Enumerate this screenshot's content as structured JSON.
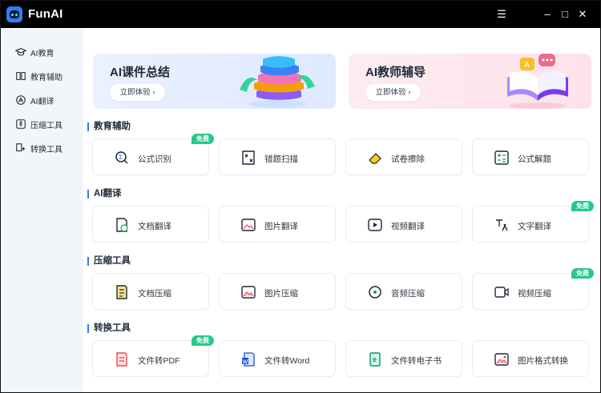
{
  "app": {
    "title": "FunAI"
  },
  "window_controls": {
    "menu": "☰",
    "minimize": "–",
    "maximize": "□",
    "close": "✕"
  },
  "sidebar": {
    "items": [
      {
        "label": "AI教育",
        "icon": "graduation-cap-icon"
      },
      {
        "label": "教育辅助",
        "icon": "book-icon"
      },
      {
        "label": "AI翻译",
        "icon": "translate-icon"
      },
      {
        "label": "压缩工具",
        "icon": "compress-icon"
      },
      {
        "label": "转换工具",
        "icon": "convert-icon"
      }
    ]
  },
  "banners": [
    {
      "title": "AI课件总结",
      "button": "立即体验 ›",
      "color": "#e9f1ff"
    },
    {
      "title": "AI教师辅导",
      "button": "立即体验 ›",
      "color": "#fde8ef"
    }
  ],
  "sections": [
    {
      "title": "教育辅助",
      "items": [
        {
          "label": "公式识别",
          "icon": "formula-recognition-icon",
          "badge": "免费"
        },
        {
          "label": "错题扫描",
          "icon": "wrong-question-scan-icon",
          "badge": ""
        },
        {
          "label": "试卷擦除",
          "icon": "eraser-icon",
          "badge": ""
        },
        {
          "label": "公式解题",
          "icon": "calculator-icon",
          "badge": ""
        }
      ]
    },
    {
      "title": "AI翻译",
      "items": [
        {
          "label": "文档翻译",
          "icon": "document-translate-icon",
          "badge": ""
        },
        {
          "label": "图片翻译",
          "icon": "image-translate-icon",
          "badge": ""
        },
        {
          "label": "视频翻译",
          "icon": "video-translate-icon",
          "badge": ""
        },
        {
          "label": "文字翻译",
          "icon": "text-translate-icon",
          "badge": "免费"
        }
      ]
    },
    {
      "title": "压缩工具",
      "items": [
        {
          "label": "文档压缩",
          "icon": "document-compress-icon",
          "badge": ""
        },
        {
          "label": "图片压缩",
          "icon": "image-compress-icon",
          "badge": ""
        },
        {
          "label": "音频压缩",
          "icon": "audio-compress-icon",
          "badge": ""
        },
        {
          "label": "视频压缩",
          "icon": "video-compress-icon",
          "badge": "免费"
        }
      ]
    },
    {
      "title": "转换工具",
      "items": [
        {
          "label": "文件转PDF",
          "icon": "file-to-pdf-icon",
          "badge": "免费"
        },
        {
          "label": "文件转Word",
          "icon": "file-to-word-icon",
          "badge": ""
        },
        {
          "label": "文件转电子书",
          "icon": "file-to-ebook-icon",
          "badge": ""
        },
        {
          "label": "图片格式转换",
          "icon": "image-format-convert-icon",
          "badge": ""
        }
      ]
    }
  ]
}
